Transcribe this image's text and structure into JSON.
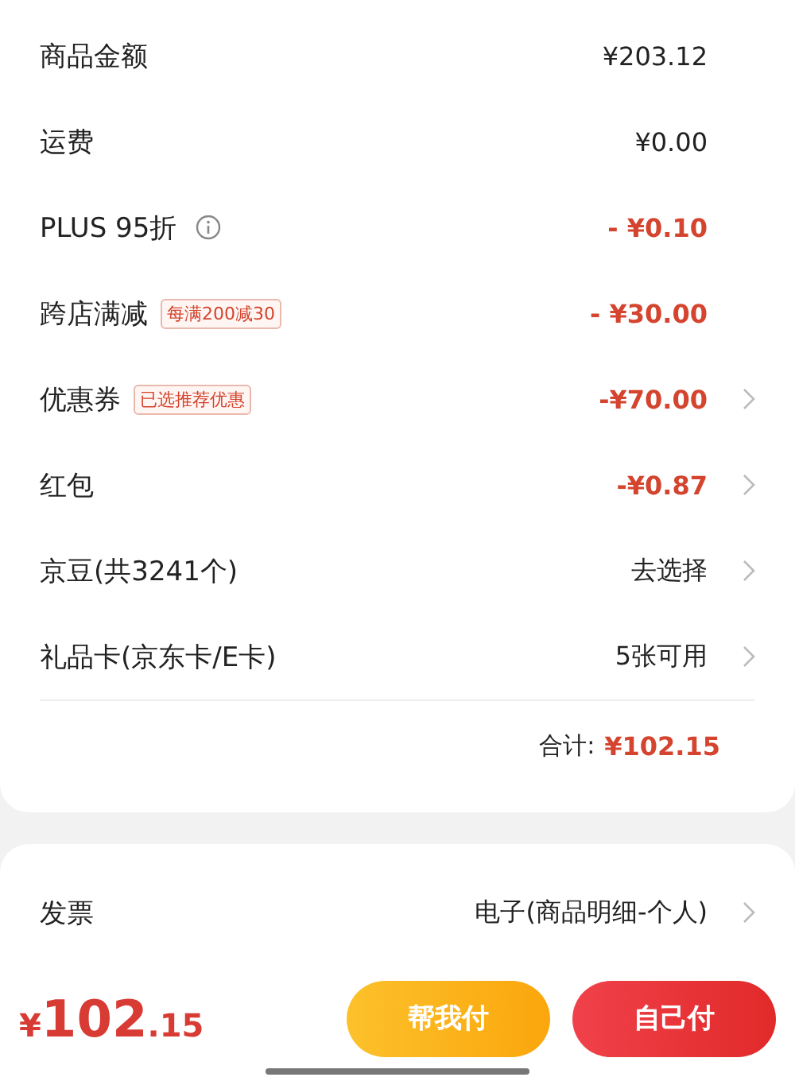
{
  "summary": {
    "rows": [
      {
        "label": "商品金额",
        "value": "¥203.12",
        "discount": false,
        "info": false,
        "chevron": false
      },
      {
        "label": "运费",
        "value": "¥0.00",
        "discount": false,
        "info": false,
        "chevron": false
      },
      {
        "label": "PLUS 95折",
        "value": "- ¥0.10",
        "discount": true,
        "info": true,
        "chevron": false
      },
      {
        "label": "跨店满减",
        "tag": "每满200减30",
        "value": "- ¥30.00",
        "discount": true,
        "info": false,
        "chevron": false
      },
      {
        "label": "优惠券",
        "tag": "已选推荐优惠",
        "value": "-¥70.00",
        "discount": true,
        "info": false,
        "chevron": true
      },
      {
        "label": "红包",
        "value": "-¥0.87",
        "discount": true,
        "info": false,
        "chevron": true
      },
      {
        "label": "京豆(共3241个)",
        "value": "去选择",
        "discount": false,
        "info": false,
        "chevron": true
      },
      {
        "label": "礼品卡(京东卡/E卡)",
        "value": "5张可用",
        "discount": false,
        "info": false,
        "chevron": true
      }
    ],
    "total_label": "合计:",
    "total_value": "¥102.15"
  },
  "invoice": {
    "label": "发票",
    "value": "电子(商品明细-个人)",
    "chevron": true
  },
  "bottom_bar": {
    "currency": "¥",
    "amount": "102",
    "cents": ".15",
    "buttons": [
      {
        "label": "帮我付",
        "kind": "secondary"
      },
      {
        "label": "自己付",
        "kind": "primary"
      }
    ]
  }
}
